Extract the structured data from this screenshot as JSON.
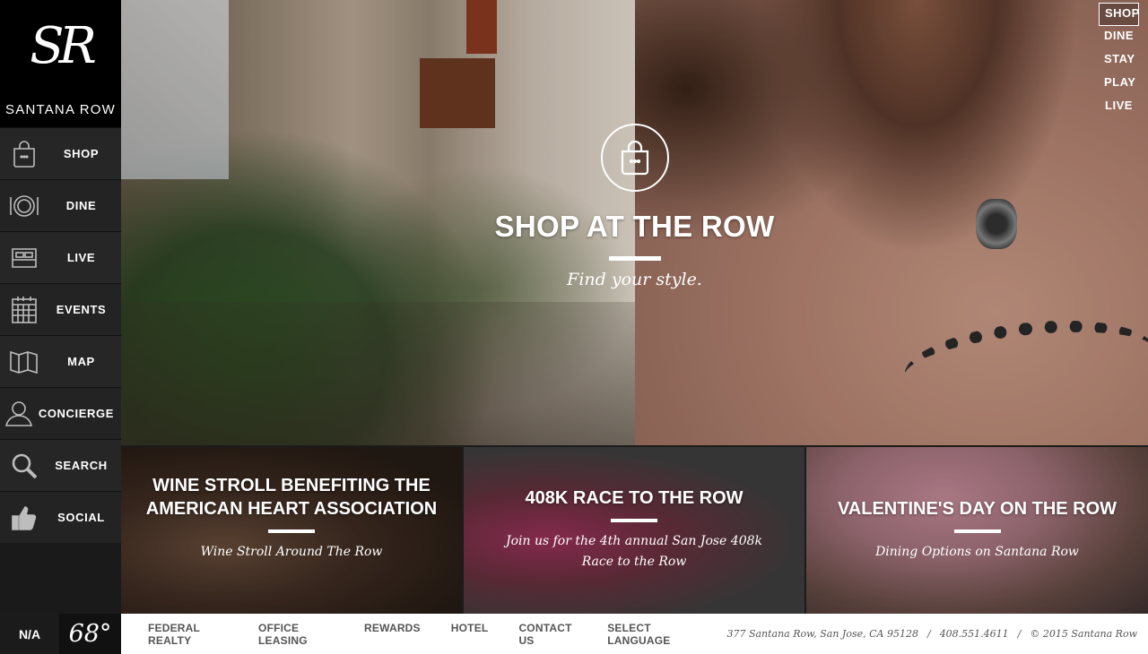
{
  "brand": {
    "monogram": "SR",
    "name": "SANTANA ROW"
  },
  "sidebar": {
    "items": [
      {
        "label": "SHOP",
        "icon": "shopping-bag-icon"
      },
      {
        "label": "DINE",
        "icon": "plate-icon"
      },
      {
        "label": "LIVE",
        "icon": "bed-icon"
      },
      {
        "label": "EVENTS",
        "icon": "calendar-icon"
      },
      {
        "label": "MAP",
        "icon": "map-icon"
      },
      {
        "label": "CONCIERGE",
        "icon": "person-icon"
      },
      {
        "label": "SEARCH",
        "icon": "search-icon"
      },
      {
        "label": "SOCIAL",
        "icon": "thumbs-up-icon"
      }
    ]
  },
  "weather": {
    "condition": "N/A",
    "temperature": "68°"
  },
  "topnav": {
    "items": [
      "SHOP",
      "DINE",
      "STAY",
      "PLAY",
      "LIVE"
    ],
    "active": "SHOP"
  },
  "hero": {
    "icon": "shopping-bag-icon",
    "title": "SHOP AT THE ROW",
    "subtitle": "Find your style."
  },
  "tiles": [
    {
      "title": "WINE STROLL BENEFITING THE AMERICAN HEART ASSOCIATION",
      "subtitle": "Wine Stroll Around The Row"
    },
    {
      "title": "408K RACE TO THE ROW",
      "subtitle": "Join us for the 4th annual San Jose 408k Race to the Row"
    },
    {
      "title": "VALENTINE'S DAY ON THE ROW",
      "subtitle": "Dining Options on Santana Row"
    }
  ],
  "footer": {
    "links": [
      "FEDERAL REALTY",
      "OFFICE LEASING",
      "REWARDS",
      "HOTEL",
      "CONTACT US",
      "SELECT LANGUAGE"
    ],
    "address": "377 Santana Row, San Jose, CA 95128",
    "phone": "408.551.4611",
    "copyright": "© 2015 Santana Row",
    "separator": "/"
  },
  "colors": {
    "sidebar_bg": "#1a1a1a",
    "logo_bg": "#000000",
    "footer_bg": "#ffffff",
    "footer_text": "#555555"
  }
}
